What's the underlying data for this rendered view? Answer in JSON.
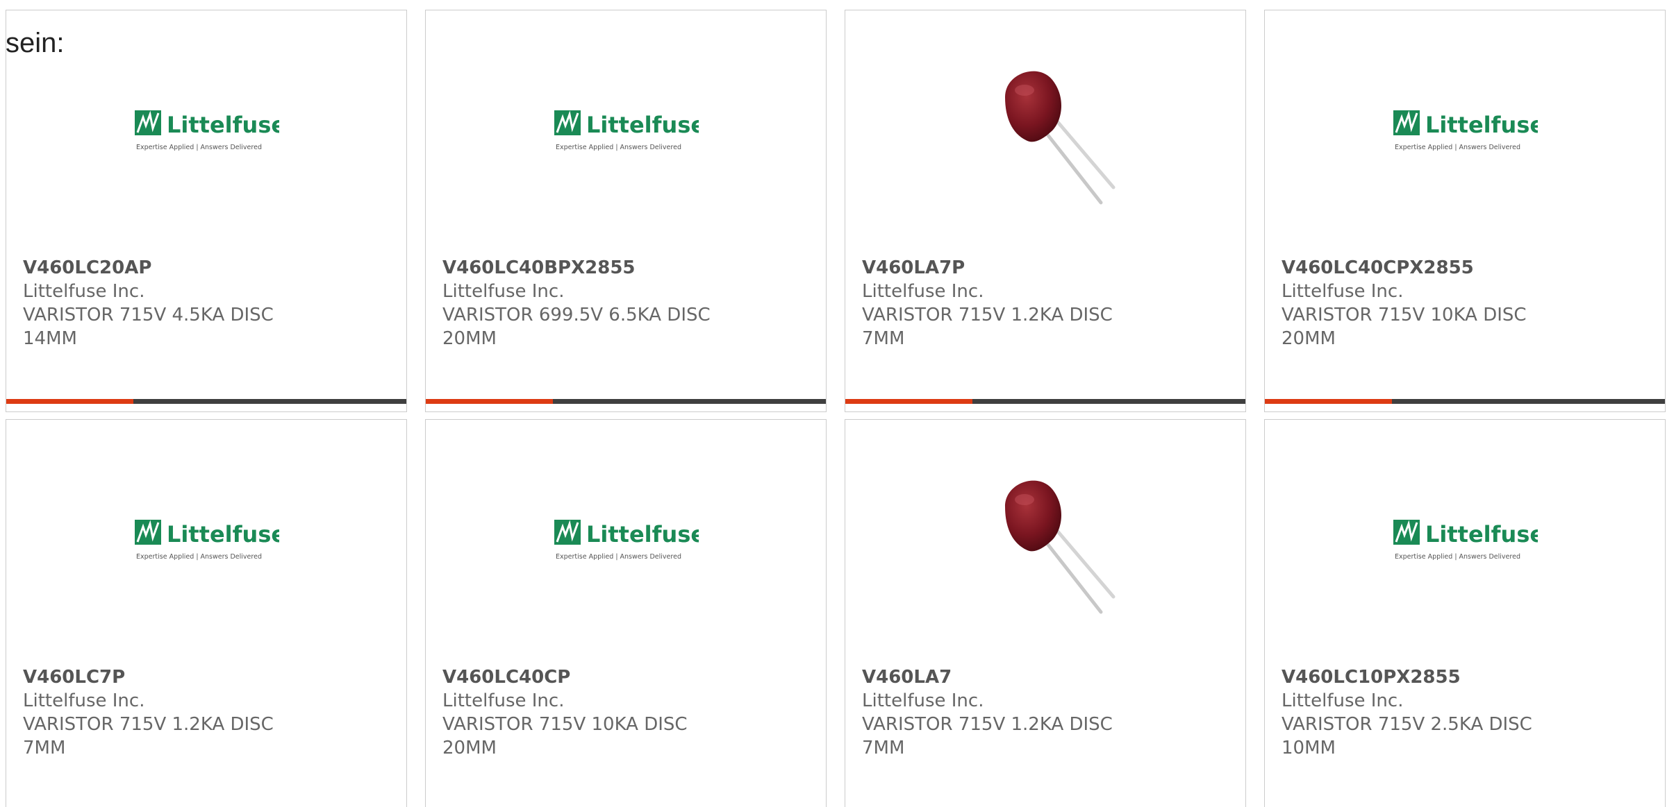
{
  "intro": {
    "text": "sein:"
  },
  "logo": {
    "brand": "Littelfuse",
    "tagline": "Expertise Applied | Answers Delivered"
  },
  "colors": {
    "brand_green": "#1a8a55",
    "accent_orange": "#dd3b13",
    "bar_dark": "#3f3f3f",
    "varistor_red": "#7a1520"
  },
  "products": [
    {
      "part": "V460LC20AP",
      "maker": "Littelfuse Inc.",
      "desc": "VARISTOR 715V 4.5KA DISC 14MM",
      "image": "littelfuse-logo"
    },
    {
      "part": "V460LC40BPX2855",
      "maker": "Littelfuse Inc.",
      "desc": "VARISTOR 699.5V 6.5KA DISC 20MM",
      "image": "littelfuse-logo"
    },
    {
      "part": "V460LA7P",
      "maker": "Littelfuse Inc.",
      "desc": "VARISTOR 715V 1.2KA DISC 7MM",
      "image": "varistor-photo"
    },
    {
      "part": "V460LC40CPX2855",
      "maker": "Littelfuse Inc.",
      "desc": "VARISTOR 715V 10KA DISC 20MM",
      "image": "littelfuse-logo"
    },
    {
      "part": "V460LC7P",
      "maker": "Littelfuse Inc.",
      "desc": "VARISTOR 715V 1.2KA DISC 7MM",
      "image": "littelfuse-logo"
    },
    {
      "part": "V460LC40CP",
      "maker": "Littelfuse Inc.",
      "desc": "VARISTOR 715V 10KA DISC 20MM",
      "image": "littelfuse-logo"
    },
    {
      "part": "V460LA7",
      "maker": "Littelfuse Inc.",
      "desc": "VARISTOR 715V 1.2KA DISC 7MM",
      "image": "varistor-photo"
    },
    {
      "part": "V460LC10PX2855",
      "maker": "Littelfuse Inc.",
      "desc": "VARISTOR 715V 2.5KA DISC 10MM",
      "image": "littelfuse-logo"
    }
  ]
}
